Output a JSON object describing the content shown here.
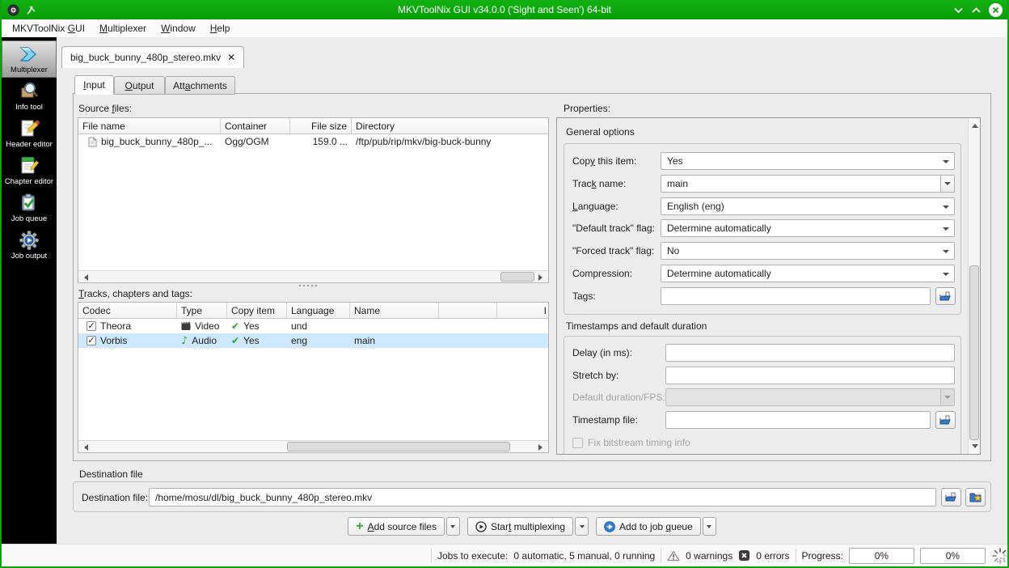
{
  "theme": {
    "titlebar_green": "#0ea30e",
    "selection_blue": "#cde8ff",
    "check_green": "#2fa12f",
    "sidebar_black": "#000000"
  },
  "window": {
    "title": "MKVToolNix GUI v34.0.0 ('Sight and Seen') 64-bit"
  },
  "menu": {
    "items": [
      "MKVToolNix &GUI",
      "&Multiplexer",
      "&Window",
      "&Help"
    ]
  },
  "sidebar": {
    "items": [
      {
        "label": "Multiplexer",
        "icon": "multiplexer-icon",
        "selected": true
      },
      {
        "label": "Info tool",
        "icon": "info-tool-icon",
        "selected": false
      },
      {
        "label": "Header editor",
        "icon": "header-editor-icon",
        "selected": false
      },
      {
        "label": "Chapter editor",
        "icon": "chapter-editor-icon",
        "selected": false
      },
      {
        "label": "Job queue",
        "icon": "job-queue-icon",
        "selected": false
      },
      {
        "label": "Job output",
        "icon": "job-output-icon",
        "selected": false
      }
    ]
  },
  "file_tab": {
    "label": "big_buck_bunny_480p_stereo.mkv",
    "close_glyph": "✕"
  },
  "tabs": [
    "&Input",
    "&Output",
    "Att&achments"
  ],
  "source_files": {
    "label": "Source &files:",
    "columns": [
      "File name",
      "Container",
      "File size",
      "Directory"
    ],
    "rows": [
      {
        "file_name": "big_buck_bunny_480p_...",
        "container": "Ogg/OGM",
        "file_size": "159.0 ...",
        "directory": "/ftp/pub/rip/mkv/big-buck-bunny"
      }
    ]
  },
  "tracks": {
    "label": "&Tracks, chapters and tags:",
    "columns": [
      "Codec",
      "Type",
      "Copy item",
      "Language",
      "Name",
      "",
      "I"
    ],
    "rows": [
      {
        "checked": true,
        "codec": "Theora",
        "type": "Video",
        "copy": "Yes",
        "language": "und",
        "name": "",
        "selected": false
      },
      {
        "checked": true,
        "codec": "Vorbis",
        "type": "Audio",
        "copy": "Yes",
        "language": "eng",
        "name": "main",
        "selected": true
      }
    ]
  },
  "properties": {
    "label": "Properties:",
    "general": {
      "title": "General options",
      "copy_this_item": {
        "label": "Cop&y this item:",
        "value": "Yes"
      },
      "track_name": {
        "label": "Trac&k name:",
        "value": "main"
      },
      "language": {
        "label": "&Language:",
        "value": "English (eng)"
      },
      "default_track_flag": {
        "label": "\"Default track\" flag:",
        "value": "Determine automatically"
      },
      "forced_track_flag": {
        "label": "\"Forced track\" flag:",
        "value": "No"
      },
      "compression": {
        "label": "Compression:",
        "value": "Determine automatically"
      },
      "tags": {
        "label": "Tags:",
        "value": ""
      }
    },
    "timestamps": {
      "title": "Timestamps and default duration",
      "delay": {
        "label": "Delay (in ms):",
        "value": ""
      },
      "stretch_by": {
        "label": "Stretch by:",
        "value": ""
      },
      "default_duration": {
        "label": "Default duration/FPS:",
        "value": "",
        "disabled": true
      },
      "timestamp_file": {
        "label": "Timestamp file:",
        "value": ""
      },
      "fix_bitstream": {
        "label": "Fix bitstream timing info",
        "checked": false,
        "disabled": true
      }
    }
  },
  "destination": {
    "group_label": "Destination file",
    "label": "Destination file:",
    "value": "/home/mosu/dl/big_buck_bunny_480p_stereo.mkv"
  },
  "actions": {
    "add_source_files": "&Add source files",
    "start_multiplexing": "Star&t multiplexing",
    "add_to_job_queue": "Add to job &queue"
  },
  "statusbar": {
    "jobs_label": "Jobs to execute:",
    "jobs_value": "0 automatic, 5 manual, 0 running",
    "warnings": "0 warnings",
    "errors": "0 errors",
    "progress_label": "Progress:",
    "progress_left": "0%",
    "progress_right": "0%"
  },
  "icons": {
    "checkbox_check": "✓",
    "yes_check": "✔",
    "audio_note": "♪"
  }
}
